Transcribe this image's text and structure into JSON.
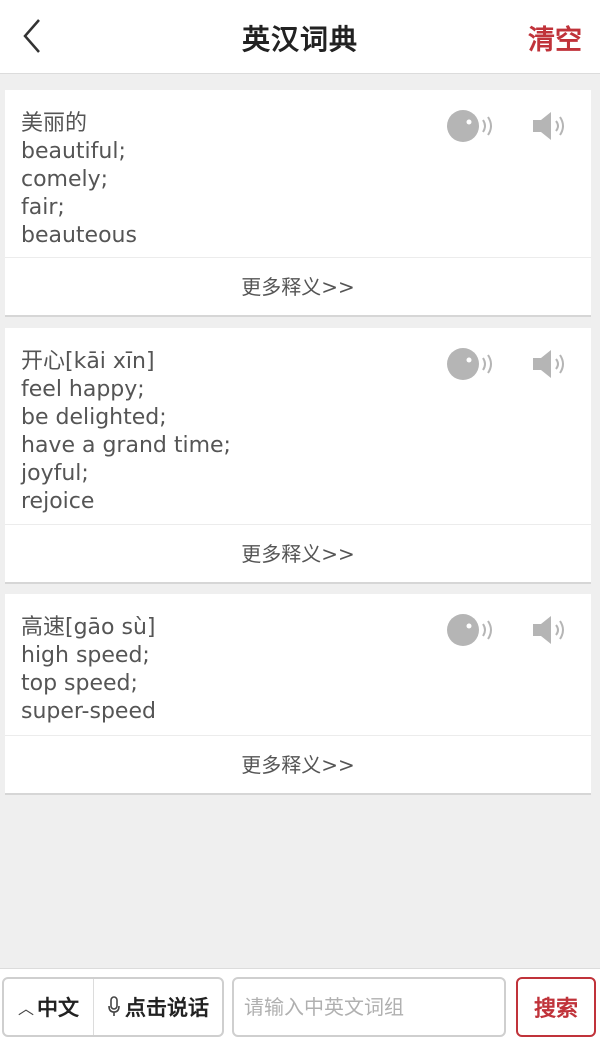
{
  "header": {
    "title": "英汉词典",
    "clear_label": "清空"
  },
  "entries": [
    {
      "word": "美丽的",
      "definitions": [
        "beautiful;",
        "comely;",
        "fair;",
        "beauteous"
      ],
      "more_label": "更多释义>>"
    },
    {
      "word": "开心[kāi xīn]",
      "definitions": [
        "feel happy;",
        "be delighted;",
        "have a grand time;",
        "joyful;",
        "rejoice"
      ],
      "more_label": "更多释义>>"
    },
    {
      "word": "高速[gāo sù]",
      "definitions": [
        "high speed;",
        "top speed;",
        "super-speed"
      ],
      "more_label": "更多释义>>"
    }
  ],
  "bottom_bar": {
    "lang_label": "中文",
    "voice_label": "点击说话",
    "search_placeholder": "请输入中英文词组",
    "search_value": "",
    "search_label": "搜索"
  },
  "colors": {
    "accent": "#c0333a",
    "icon_gray": "#b5b5b5"
  }
}
